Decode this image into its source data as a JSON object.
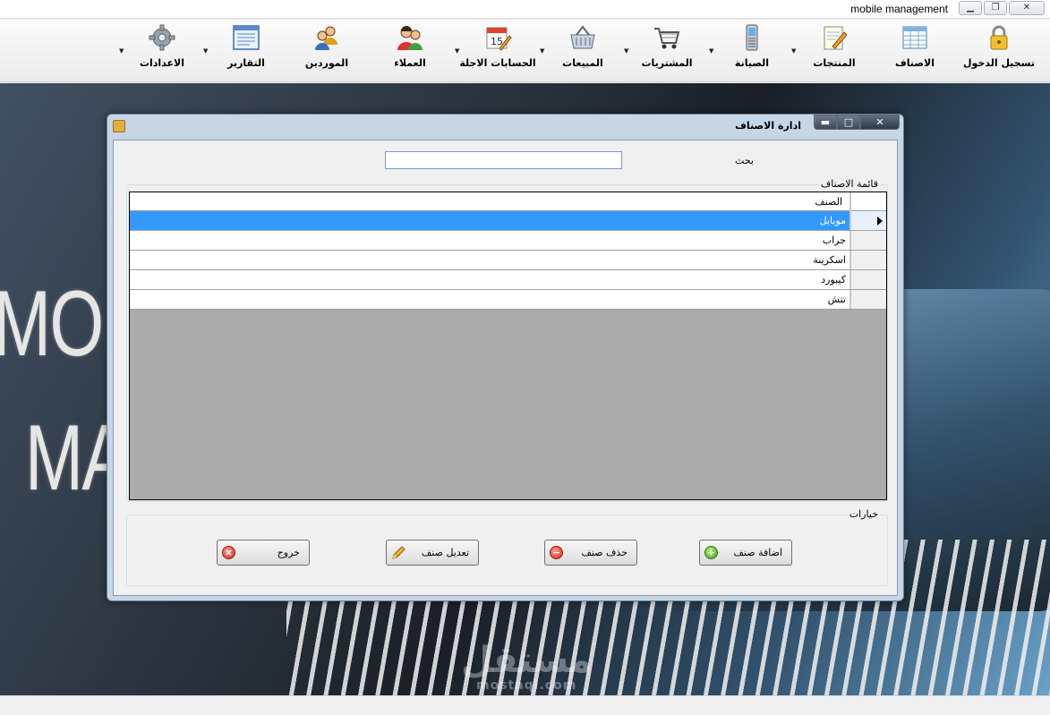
{
  "window": {
    "title": "mobile management"
  },
  "menu": {
    "items": [
      {
        "label": "تسجيل الدخول",
        "icon": "lock-icon",
        "has_dropdown": false
      },
      {
        "label": "الاصناف",
        "icon": "grid-table-icon",
        "has_dropdown": false
      },
      {
        "label": "المنتجات",
        "icon": "notepad-pencil-icon",
        "has_dropdown": true
      },
      {
        "label": "الصيانة",
        "icon": "mobile-phone-icon",
        "has_dropdown": true
      },
      {
        "label": "المشتريات",
        "icon": "shopping-cart-icon",
        "has_dropdown": true
      },
      {
        "label": "المبيعات",
        "icon": "basket-icon",
        "has_dropdown": true
      },
      {
        "label": "الحسابات الاجلة",
        "icon": "calendar-icon",
        "has_dropdown": true
      },
      {
        "label": "العملاء",
        "icon": "customers-icon",
        "has_dropdown": false
      },
      {
        "label": "الموردين",
        "icon": "suppliers-icon",
        "has_dropdown": false
      },
      {
        "label": "التقارير",
        "icon": "report-icon",
        "has_dropdown": true
      },
      {
        "label": "الاعدادات",
        "icon": "gear-icon",
        "has_dropdown": true
      }
    ],
    "calendar_day": "15"
  },
  "background": {
    "line1": "MOB",
    "line2": "MA",
    "watermark_ar": "مستقل",
    "watermark_en": "mostaql.com"
  },
  "dialog": {
    "title": "ادارة الاصناف",
    "search_label": "بحث",
    "search_value": "",
    "list_group_label": "قائمة الاصناف",
    "grid": {
      "column_header": "الصنف",
      "rows": [
        "موبايل",
        "جراب",
        "اسكرينة",
        "كيبورد",
        "تتش"
      ],
      "selected_index": 0
    },
    "options_group_label": "خيارات",
    "buttons": {
      "add": "اضافة صنف",
      "delete": "حذف صنف",
      "edit": "تعديل صنف",
      "exit": "خروج"
    }
  },
  "colors": {
    "selection": "#3399ff",
    "grid_empty": "#ababab",
    "dialog_frame": "#c7d6e7"
  }
}
